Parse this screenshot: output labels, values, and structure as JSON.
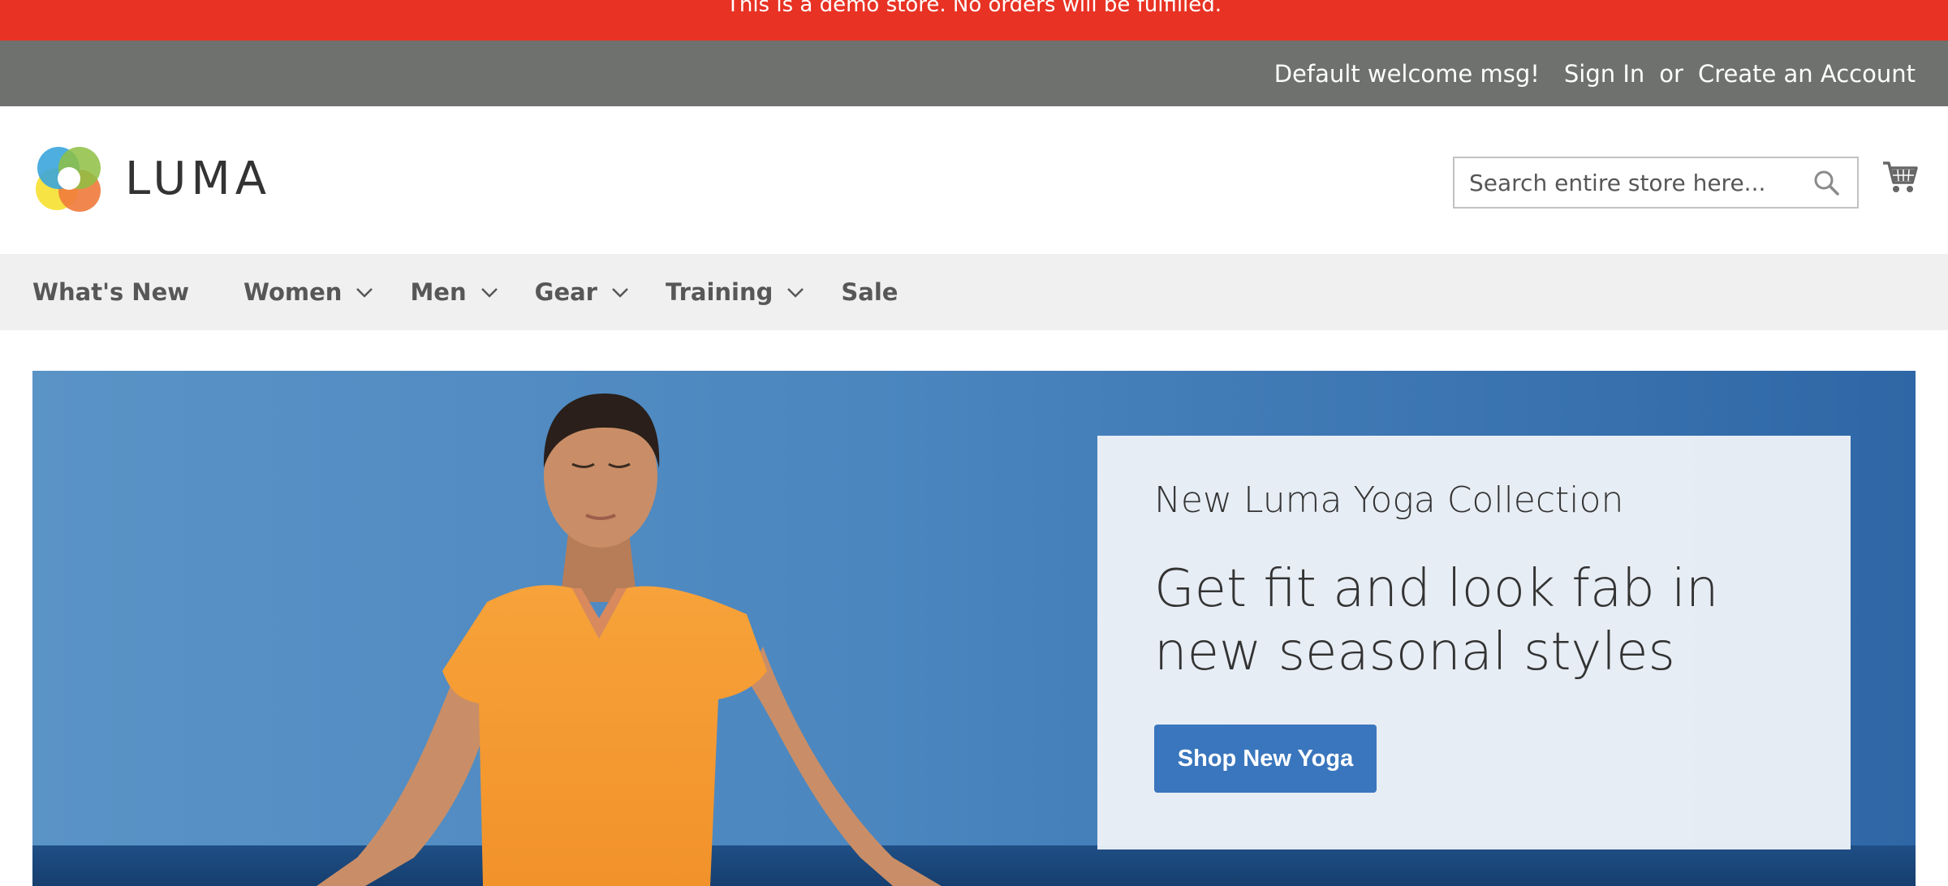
{
  "demo_notice": {
    "text": "This is a demo store. No orders will be fulfilled."
  },
  "panel": {
    "welcome": "Default welcome msg!",
    "sign_in": "Sign In",
    "or": "or",
    "create_account": "Create an Account"
  },
  "logo": {
    "text": "LUMA"
  },
  "search": {
    "placeholder": "Search entire store here...",
    "value": ""
  },
  "nav": {
    "items": [
      {
        "label": "What's New",
        "has_dropdown": false
      },
      {
        "label": "Women",
        "has_dropdown": true
      },
      {
        "label": "Men",
        "has_dropdown": true
      },
      {
        "label": "Gear",
        "has_dropdown": true
      },
      {
        "label": "Training",
        "has_dropdown": true
      },
      {
        "label": "Sale",
        "has_dropdown": false
      }
    ]
  },
  "hero": {
    "subtitle": "New Luma Yoga Collection",
    "title": "Get fit and look fab in new seasonal styles",
    "button": "Shop New Yoga"
  },
  "colors": {
    "demo_bar": "#e83224",
    "panel_bar": "#6e716e",
    "nav_bar": "#f0f0f0",
    "button": "#3a76bd"
  },
  "icons": [
    "luma-logo-icon",
    "search-icon",
    "cart-icon",
    "chevron-down-icon"
  ]
}
